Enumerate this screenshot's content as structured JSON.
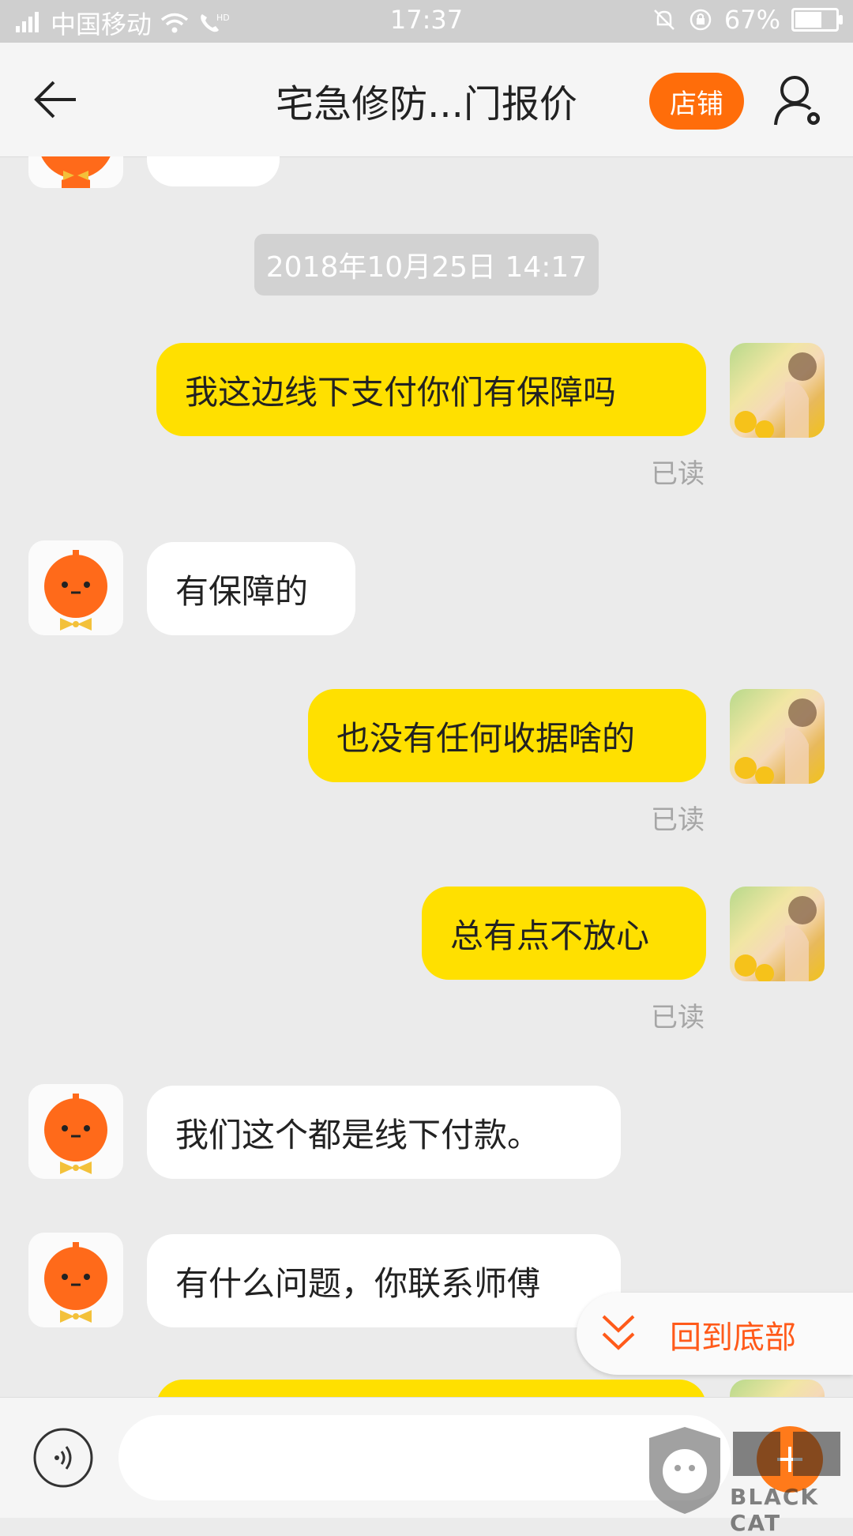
{
  "status_bar": {
    "carrier": "中国移动",
    "network": "4G",
    "time": "17:37",
    "battery": "67%"
  },
  "header": {
    "title": "宅急修防...门报价",
    "shop_label": "店铺",
    "accent_color": "#ff6d0a"
  },
  "chat": {
    "timestamp": "2018年10月25日 14:17",
    "messages": [
      {
        "side": "right",
        "text": "我这边线下支付你们有保障吗",
        "status": "已读"
      },
      {
        "side": "left",
        "text": "有保障的"
      },
      {
        "side": "right",
        "text": "也没有任何收据啥的",
        "status": "已读"
      },
      {
        "side": "right",
        "text": "总有点不放心",
        "status": "已读"
      },
      {
        "side": "left",
        "text": "我们这个都是线下付款。"
      },
      {
        "side": "left",
        "text": "有什么问题，你联系师傅"
      }
    ]
  },
  "back_to_bottom": {
    "label": "回到底部"
  },
  "input_bar": {
    "value": "",
    "placeholder": ""
  },
  "watermark": {
    "text": "BLACK CAT",
    "logo_text": "黑猫"
  },
  "colors": {
    "user_bubble": "#ffe000",
    "merchant_bubble": "#ffffff",
    "background": "#ebebeb"
  }
}
